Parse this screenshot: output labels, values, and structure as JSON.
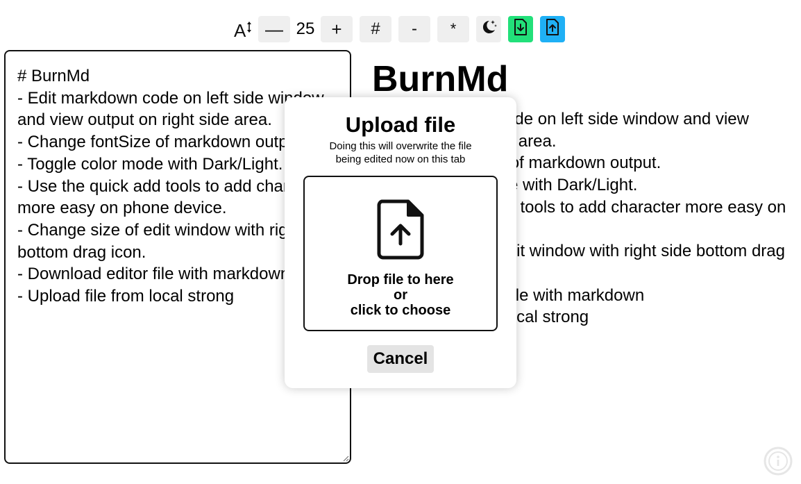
{
  "toolbar": {
    "font_size_icon": "font-size-icon",
    "decrease_label": "—",
    "font_size_value": "25",
    "increase_label": "+",
    "heading_label": "#",
    "list_label": "-",
    "bold_label": "*",
    "dark_mode_icon": "moon-stars-icon",
    "download_icon": "file-download-icon",
    "upload_icon": "file-upload-icon",
    "colors": {
      "download_bg": "#22e07a",
      "upload_bg": "#1fb0f5"
    }
  },
  "editor": {
    "content": "# BurnMd\n- Edit markdown code on left side window and view output on right side area.\n- Change fontSize of markdown output.\n- Toggle color mode with Dark/Light.\n- Use the quick add tools to add character more easy on phone device.\n- Change size of edit window with right side bottom drag icon.\n- Download editor file with markdown\n- Upload file from local strong"
  },
  "preview": {
    "title": "BurnMd",
    "items": [
      "Edit markdown code on left side window and view output on right side area.",
      "Change fontSize of markdown output.",
      "Toggle color mode with Dark/Light.",
      "Use the quick add tools to add character more easy on phone device.",
      "Change size of edit window with right side bottom drag icon.",
      "Download editor file with markdown",
      "Upload file from local strong"
    ]
  },
  "modal": {
    "title": "Upload file",
    "subtitle": "Doing this will overwrite the file being edited now on this tab",
    "drop_line1": "Drop file to here",
    "drop_line2": "or",
    "drop_line3": "click to choose",
    "cancel_label": "Cancel"
  },
  "footer": {
    "info_icon": "info-icon"
  }
}
